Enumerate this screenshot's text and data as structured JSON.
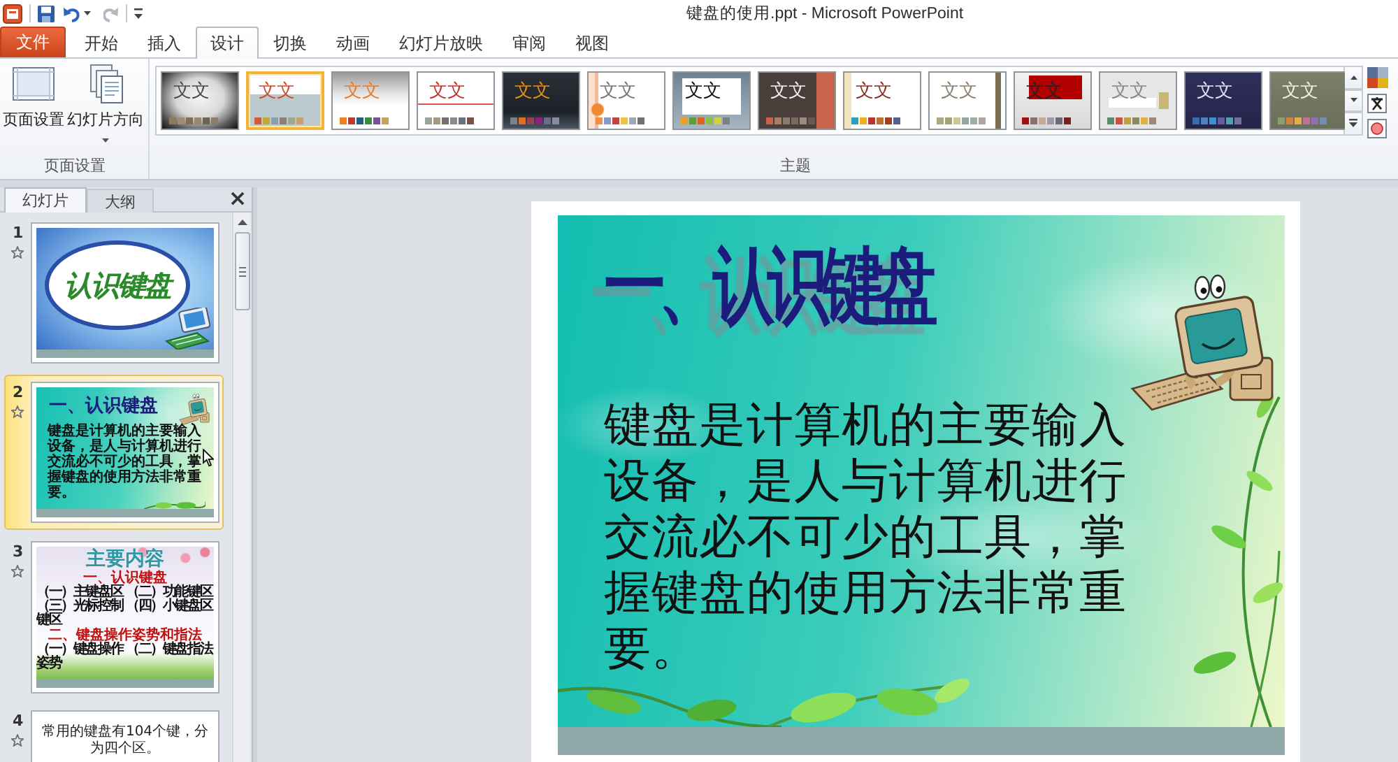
{
  "window": {
    "title": "键盘的使用.ppt - Microsoft PowerPoint"
  },
  "quick_access": [
    {
      "kind": "app",
      "disabled": false
    },
    {
      "kind": "save",
      "disabled": false
    },
    {
      "kind": "undo",
      "disabled": false
    },
    {
      "kind": "redo",
      "disabled": true
    },
    {
      "kind": "customize",
      "disabled": false
    }
  ],
  "ribbon": {
    "tabs": [
      {
        "label": "文件",
        "kind": "file",
        "selected": false
      },
      {
        "label": "开始",
        "kind": "tab",
        "selected": false
      },
      {
        "label": "插入",
        "kind": "tab",
        "selected": false
      },
      {
        "label": "设计",
        "kind": "tab",
        "selected": true
      },
      {
        "label": "切换",
        "kind": "tab",
        "selected": false
      },
      {
        "label": "动画",
        "kind": "tab",
        "selected": false
      },
      {
        "label": "幻灯片放映",
        "kind": "tab",
        "selected": false
      },
      {
        "label": "审阅",
        "kind": "tab",
        "selected": false
      },
      {
        "label": "视图",
        "kind": "tab",
        "selected": false
      }
    ],
    "groups": [
      {
        "kind": "page-setup",
        "label": "页面设置",
        "buttons": [
          {
            "label": "页面设置",
            "kind": "page-setup",
            "dropdown": false
          },
          {
            "label": "幻灯片方向",
            "kind": "slide-orientation",
            "dropdown": true
          }
        ]
      },
      {
        "kind": "themes",
        "label": "主题",
        "themes": [
          {
            "kind": "grunge",
            "sample": "文文",
            "selected": false,
            "palette": [
              {
                "color": "#8b7b5a"
              },
              {
                "color": "#a08c6a"
              },
              {
                "color": "#7d6e55"
              },
              {
                "color": "#9a8a6c"
              },
              {
                "color": "#6f6450"
              },
              {
                "color": "#8a7f68"
              }
            ]
          },
          {
            "kind": "slate-band",
            "sample": "文文",
            "selected": true,
            "palette": [
              {
                "color": "#d45a3a"
              },
              {
                "color": "#c8a830"
              },
              {
                "color": "#8aa0a8"
              },
              {
                "color": "#8a8078"
              },
              {
                "color": "#a0a890"
              },
              {
                "color": "#c8a070"
              }
            ]
          },
          {
            "kind": "gray-fade",
            "sample": "文文",
            "selected": false,
            "palette": [
              {
                "color": "#f07f22"
              },
              {
                "color": "#c0392b"
              },
              {
                "color": "#1f5f8b"
              },
              {
                "color": "#3b8a3e"
              },
              {
                "color": "#7a4f9a"
              },
              {
                "color": "#c8a060"
              }
            ]
          },
          {
            "kind": "red-rule",
            "sample": "文文",
            "selected": false,
            "palette": [
              {
                "color": "#9aa59a"
              },
              {
                "color": "#a89880"
              },
              {
                "color": "#7a6e6a"
              },
              {
                "color": "#8a8a8a"
              },
              {
                "color": "#6a7080"
              },
              {
                "color": "#7a5048"
              }
            ]
          },
          {
            "kind": "dark-slate",
            "sample": "文文",
            "selected": false,
            "palette": [
              {
                "color": "#7a8088"
              },
              {
                "color": "#e07020"
              },
              {
                "color": "#9a4050"
              },
              {
                "color": "#8a2080"
              },
              {
                "color": "#6a6a8a"
              },
              {
                "color": "#8a8a9a"
              }
            ]
          },
          {
            "kind": "orange-stripe",
            "sample": "文文",
            "selected": false,
            "palette": [
              {
                "color": "#f09040"
              },
              {
                "color": "#8898c8"
              },
              {
                "color": "#c84040"
              },
              {
                "color": "#f0c040"
              },
              {
                "color": "#a0a8b8"
              },
              {
                "color": "#707070"
              }
            ]
          },
          {
            "kind": "framed",
            "sample": "文文",
            "selected": false,
            "palette": [
              {
                "color": "#f0a020"
              },
              {
                "color": "#60a030"
              },
              {
                "color": "#e06020"
              },
              {
                "color": "#90c040"
              },
              {
                "color": "#d0d040"
              },
              {
                "color": "#808080"
              }
            ]
          },
          {
            "kind": "brown-stripe",
            "sample": "文文",
            "selected": false,
            "palette": [
              {
                "color": "#c8604a"
              },
              {
                "color": "#a88060"
              },
              {
                "color": "#8a7a70"
              },
              {
                "color": "#7a6a60"
              },
              {
                "color": "#9a8a80"
              },
              {
                "color": "#6a5a50"
              }
            ]
          },
          {
            "kind": "cream-edge",
            "sample": "文文",
            "selected": false,
            "palette": [
              {
                "color": "#2aa0c0"
              },
              {
                "color": "#f0b020"
              },
              {
                "color": "#c03030"
              },
              {
                "color": "#c07030"
              },
              {
                "color": "#a04020"
              },
              {
                "color": "#506090"
              }
            ]
          },
          {
            "kind": "olive-edge",
            "sample": "文文",
            "selected": false,
            "palette": [
              {
                "color": "#b0a880"
              },
              {
                "color": "#a0a870"
              },
              {
                "color": "#c8c890"
              },
              {
                "color": "#90a8a0"
              },
              {
                "color": "#a0b0a8"
              },
              {
                "color": "#b0a8a0"
              }
            ]
          },
          {
            "kind": "red-block",
            "sample": "文文",
            "selected": false,
            "palette": [
              {
                "color": "#a01010"
              },
              {
                "color": "#8a7070"
              },
              {
                "color": "#c8a890"
              },
              {
                "color": "#9a9aa8"
              },
              {
                "color": "#6a6a7a"
              },
              {
                "color": "#7a2020"
              }
            ]
          },
          {
            "kind": "gray-panel",
            "sample": "文文",
            "selected": false,
            "palette": [
              {
                "color": "#5a8a70"
              },
              {
                "color": "#d05040"
              },
              {
                "color": "#c0a040"
              },
              {
                "color": "#8a8a60"
              },
              {
                "color": "#e0b040"
              },
              {
                "color": "#a08878"
              }
            ]
          },
          {
            "kind": "navy",
            "sample": "文文",
            "selected": false,
            "palette": [
              {
                "color": "#3a6ab0"
              },
              {
                "color": "#5080c0"
              },
              {
                "color": "#3a90d0"
              },
              {
                "color": "#6060a0"
              },
              {
                "color": "#50a0b0"
              },
              {
                "color": "#7070a0"
              }
            ]
          },
          {
            "kind": "olive",
            "sample": "文文",
            "selected": false,
            "palette": [
              {
                "color": "#8aa070"
              },
              {
                "color": "#d08040"
              },
              {
                "color": "#e0b040"
              },
              {
                "color": "#c07090"
              },
              {
                "color": "#9070b0"
              },
              {
                "color": "#7090b0"
              }
            ]
          }
        ]
      }
    ]
  },
  "side_panel": {
    "tabs": [
      {
        "label": "幻灯片",
        "selected": true
      },
      {
        "label": "大纲",
        "selected": false
      }
    ],
    "slides": [
      {
        "number": "1",
        "kind": "title",
        "selected": false,
        "animated": true,
        "title": "认识键盘"
      },
      {
        "number": "2",
        "kind": "text",
        "selected": true,
        "animated": true,
        "title": "一、认识键盘",
        "body": "键盘是计算机的主要输入设备，是人与计算机进行交流必不可少的工具，掌握键盘的使用方法非常重要。"
      },
      {
        "number": "3",
        "kind": "contents",
        "selected": false,
        "animated": true,
        "title": "主要内容",
        "sections": [
          {
            "heading": "一、认识键盘",
            "items": [
              "（一）主键盘区",
              "（二）功能键区",
              "（三）光标控制键区",
              "（四）小键盘区"
            ]
          },
          {
            "heading": "二、键盘操作姿势和指法",
            "items": [
              "（一）键盘操作姿势",
              "（二）键盘指法"
            ]
          }
        ]
      },
      {
        "number": "4",
        "kind": "diagram",
        "selected": false,
        "animated": true,
        "text": "常用的键盘有104个键，分为四个区。"
      }
    ]
  },
  "editor": {
    "title": "一、认识键盘",
    "body": "键盘是计算机的主要输入设备，是人与计算机进行交流必不可少的工具，掌握键盘的使用方法非常重要。"
  }
}
